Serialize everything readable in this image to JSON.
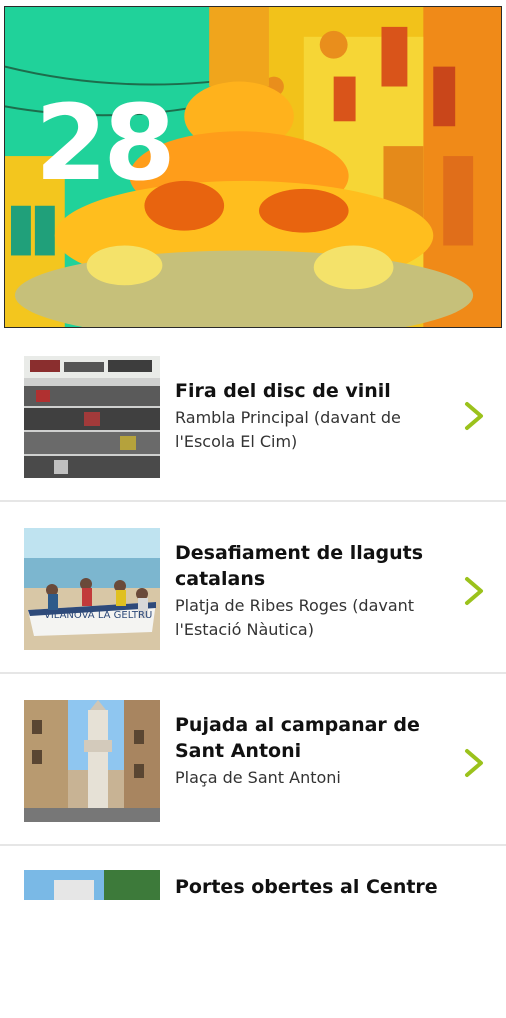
{
  "hero": {
    "day": "28"
  },
  "colors": {
    "accent": "#9bc21c",
    "hero_green": "#20d29a",
    "divider": "#e6e6e6"
  },
  "events": [
    {
      "title": "Fira del disc de vinil",
      "location": "Rambla Principal (davant de l'Escola El Cim)"
    },
    {
      "title": "Desafiament de llaguts catalans",
      "location": "Platja de Ribes Roges (davant l'Estació Nàutica)"
    },
    {
      "title": "Pujada al campanar de Sant Antoni",
      "location": "Plaça de Sant Antoni"
    },
    {
      "title": "Portes obertes al Centre",
      "location": ""
    }
  ],
  "icons": {
    "chevron": "chevron-right-icon"
  },
  "thumbs": {
    "boat_text": "VILANOVA LA GELTRU"
  }
}
